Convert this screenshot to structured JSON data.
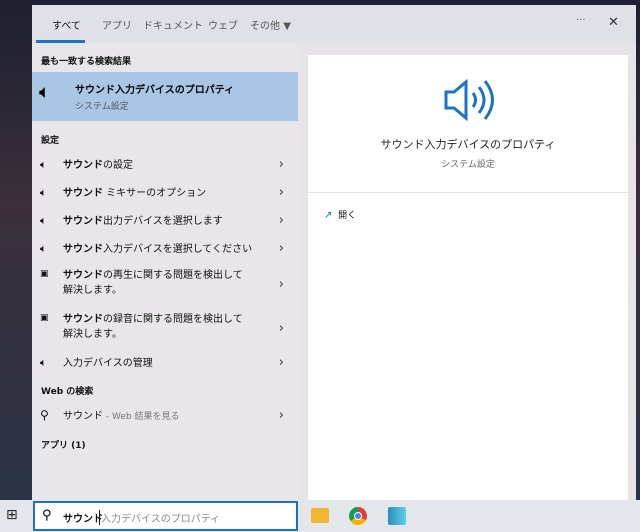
{
  "tabs": [
    "すべて",
    "アプリ",
    "ドキュメント",
    "ウェブ",
    "その他"
  ],
  "window_controls": {
    "more": "···",
    "close": "✕"
  },
  "best_match": {
    "header": "最も一致する検索結果",
    "title": "サウンド入力デバイスのプロパティ",
    "subtitle": "システム設定"
  },
  "settings": {
    "header": "設定",
    "items": [
      {
        "bold": "サウンド",
        "rest": "の設定"
      },
      {
        "bold": "サウンド",
        "rest": " ミキサーのオプション"
      },
      {
        "bold": "サウンド",
        "rest": "出力デバイスを選択します"
      },
      {
        "bold": "サウンド",
        "rest": "入力デバイスを選択してください"
      },
      {
        "bold": "サウンド",
        "rest": "の再生に関する問題を検出して",
        "line2": "解決します。"
      },
      {
        "bold": "サウンド",
        "rest": "の録音に関する問題を検出して",
        "line2": "解決します。"
      },
      {
        "bold": "",
        "rest": "入力デバイスの管理"
      }
    ]
  },
  "web": {
    "header": "Web の検索",
    "query": "サウンド",
    "suffix": " - Web 結果を見る"
  },
  "apps": {
    "header": "アプリ (1)"
  },
  "preview": {
    "title": "サウンド入力デバイスのプロパティ",
    "subtitle": "システム設定",
    "open": "開く"
  },
  "search": {
    "typed": "サウンド",
    "suggestion": "入力デバイスのプロパティ"
  },
  "colors": {
    "accent": "#1a73c8",
    "highlight": "#a9c6e4"
  }
}
